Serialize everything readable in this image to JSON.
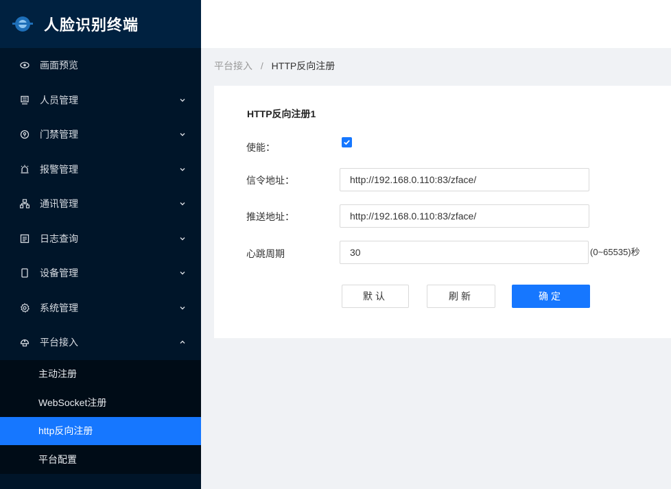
{
  "app": {
    "title": "人脸识别终端"
  },
  "sidebar": {
    "items": [
      {
        "label": "画面预览",
        "icon": "eye-icon",
        "has_arrow": false
      },
      {
        "label": "人员管理",
        "icon": "person-card-icon",
        "has_arrow": true
      },
      {
        "label": "门禁管理",
        "icon": "door-lock-icon",
        "has_arrow": true
      },
      {
        "label": "报警管理",
        "icon": "alarm-icon",
        "has_arrow": true
      },
      {
        "label": "通讯管理",
        "icon": "network-icon",
        "has_arrow": true
      },
      {
        "label": "日志查询",
        "icon": "log-icon",
        "has_arrow": true
      },
      {
        "label": "设备管理",
        "icon": "device-icon",
        "has_arrow": true
      },
      {
        "label": "系统管理",
        "icon": "gear-icon",
        "has_arrow": true
      },
      {
        "label": "平台接入",
        "icon": "platform-icon",
        "has_arrow": true,
        "expanded": true
      }
    ],
    "sub_items": [
      {
        "label": "主动注册",
        "active": false
      },
      {
        "label": "WebSocket注册",
        "active": false
      },
      {
        "label": "http反向注册",
        "active": true
      },
      {
        "label": "平台配置",
        "active": false
      }
    ]
  },
  "breadcrumb": {
    "parent": "平台接入",
    "separator": "/",
    "current": "HTTP反向注册"
  },
  "form": {
    "title": "HTTP反向注册1",
    "enable_label": "使能：",
    "enable_checked": true,
    "signal_label": "信令地址：",
    "signal_value": "http://192.168.0.110:83/zface/",
    "push_label": "推送地址：",
    "push_value": "http://192.168.0.110:83/zface/",
    "heartbeat_label": "心跳周期",
    "heartbeat_value": "30",
    "heartbeat_hint": "(0~65535)秒"
  },
  "buttons": {
    "default": "默认",
    "refresh": "刷新",
    "confirm": "确定"
  },
  "colors": {
    "sidebar_bg": "#001529",
    "accent": "#1677ff",
    "logo_bg": "#002140"
  }
}
